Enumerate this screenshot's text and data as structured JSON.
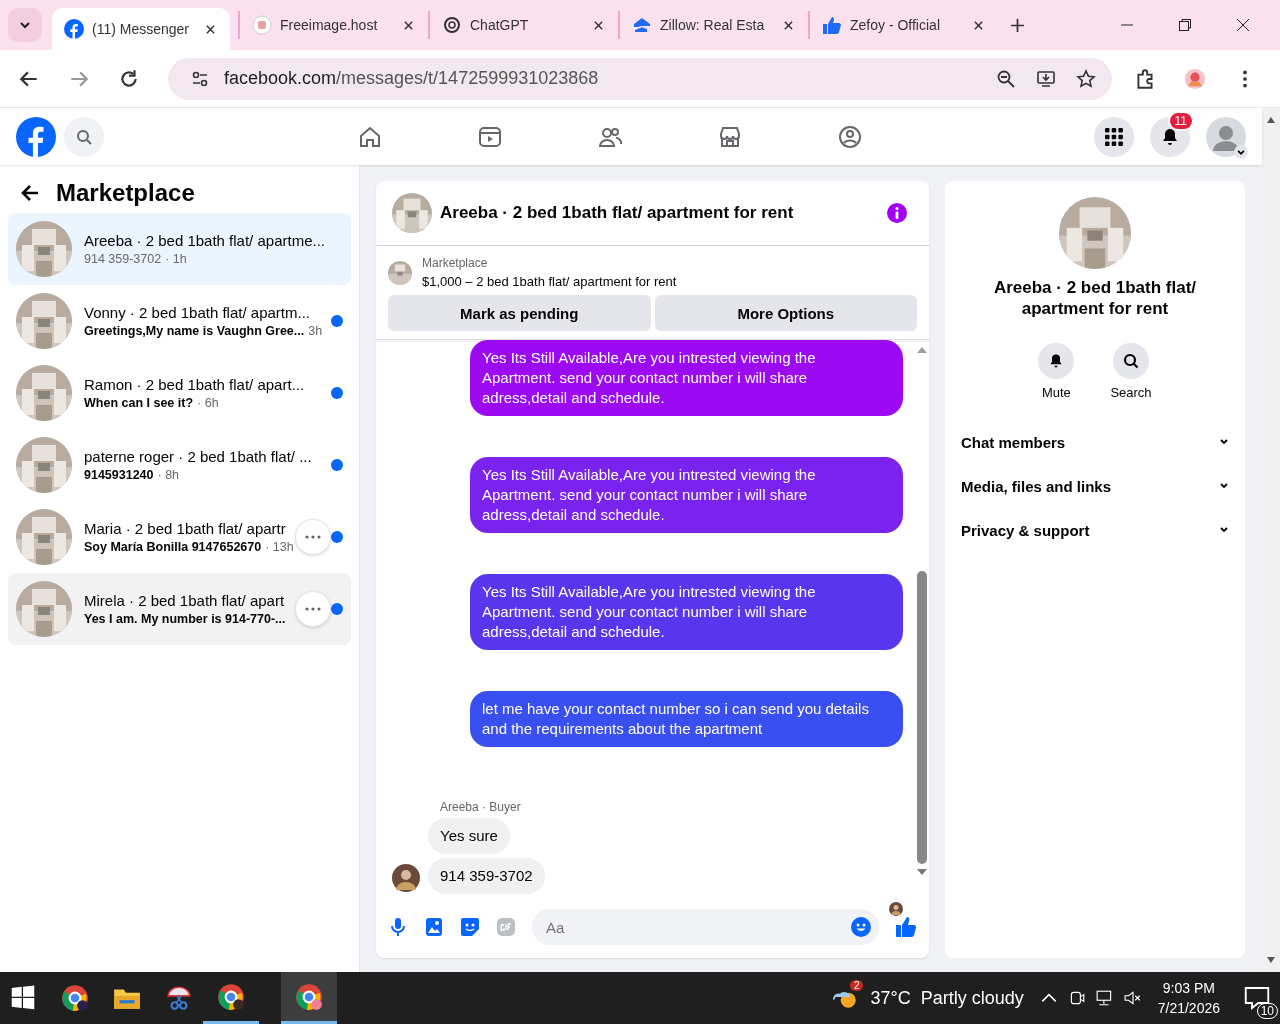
{
  "browser": {
    "tabs": [
      {
        "title": "(11) Messenger",
        "selected": true
      },
      {
        "title": "Freeimage.host",
        "selected": false
      },
      {
        "title": "ChatGPT",
        "selected": false
      },
      {
        "title": "Zillow: Real Esta",
        "selected": false
      },
      {
        "title": "Zefoy - Official",
        "selected": false
      }
    ],
    "url": {
      "host": "facebook.com",
      "path": "/messages/t/1472599931023868"
    }
  },
  "topbar": {
    "notifications": "11"
  },
  "sidebar": {
    "title": "Marketplace",
    "conversations": [
      {
        "name": "Areeba · 2 bed 1bath flat/ apartme...",
        "preview": "914 359-3702",
        "time": "· 1h",
        "selected": true,
        "hovered": false,
        "unread": false,
        "menu": false
      },
      {
        "name": "Vonny · 2 bed 1bath flat/ apartm...",
        "preview": "Greetings,My name is Vaughn Gree...",
        "time": "3h",
        "selected": false,
        "hovered": false,
        "unread": true,
        "menu": false
      },
      {
        "name": "Ramon · 2 bed 1bath flat/ apart...",
        "preview": "When can I see it?",
        "time": "· 6h",
        "selected": false,
        "hovered": false,
        "unread": true,
        "menu": false
      },
      {
        "name": "paterne roger · 2 bed 1bath flat/ ...",
        "preview": "9145931240",
        "time": "· 8h",
        "selected": false,
        "hovered": false,
        "unread": true,
        "menu": false
      },
      {
        "name": "Maria · 2 bed 1bath flat/ apartr",
        "preview": "Soy María Bonilla 9147652670",
        "time": "· 13h",
        "selected": false,
        "hovered": false,
        "unread": true,
        "menu": true
      },
      {
        "name": "Mirela · 2 bed 1bath flat/ apart",
        "preview": "Yes I am. My number is 914-770-...",
        "selected": false,
        "hovered": true,
        "unread": true,
        "menu": true
      }
    ]
  },
  "chat": {
    "title": "Areeba · 2 bed 1bath flat/ apartment for rent",
    "listing": {
      "label": "Marketplace",
      "text": "$1,000 – 2 bed 1bath flat/ apartment for rent"
    },
    "buttons": [
      "Mark as pending",
      "More Options"
    ],
    "messages": [
      {
        "kind": "sent",
        "text": "Yes Its Still Available,Are you intrested viewing the Apartment. send your contact number i will share adress,detail and schedule.",
        "color": "#9b0af0"
      },
      {
        "kind": "sent",
        "text": "Yes Its Still Available,Are you intrested viewing the Apartment. send your contact number i will share adress,detail and schedule.",
        "color": "#7a22ee"
      },
      {
        "kind": "sent",
        "text": "Yes Its Still Available,Are you intrested viewing the Apartment. send your contact number i will share adress,detail and schedule.",
        "color": "#5a35ee"
      },
      {
        "kind": "sent",
        "text": "let me have your contact number so i can send you details and the requirements about the apartment",
        "color": "#3a4ff0"
      },
      {
        "kind": "sender",
        "text": "Areeba · Buyer"
      },
      {
        "kind": "received",
        "text": "Yes sure"
      },
      {
        "kind": "received",
        "text": "914 359-3702",
        "avatar": true
      }
    ],
    "composer": {
      "placeholder": "Aa"
    }
  },
  "details": {
    "title": "Areeba · 2 bed 1bath flat/ apartment for rent",
    "actions": [
      {
        "label": "Mute",
        "kind": "bell"
      },
      {
        "label": "Search",
        "kind": "search"
      }
    ],
    "sections": [
      "Chat members",
      "Media, files and links",
      "Privacy & support"
    ]
  },
  "taskbar": {
    "weather_badge": "2",
    "temperature": "37°C",
    "condition": "Partly cloudy",
    "time": "9:03 PM",
    "date": "7/21/2026",
    "notifications": "10"
  }
}
